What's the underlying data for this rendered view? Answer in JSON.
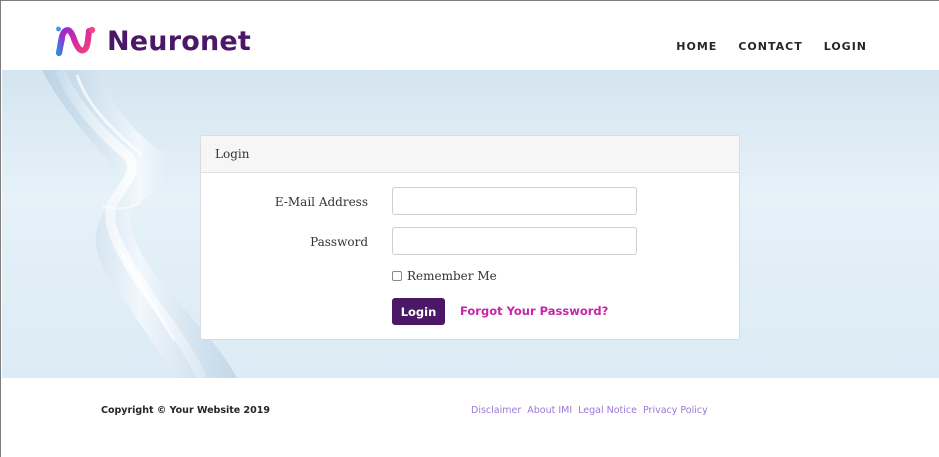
{
  "brand": {
    "name": "Neuronet",
    "logo_icon": "neuronet-logo-icon"
  },
  "nav": {
    "items": [
      {
        "label": "HOME"
      },
      {
        "label": "CONTACT"
      },
      {
        "label": "LOGIN"
      }
    ]
  },
  "login_card": {
    "title": "Login",
    "email_label": "E-Mail Address",
    "email_value": "",
    "password_label": "Password",
    "password_value": "",
    "remember_label": "Remember Me",
    "remember_checked": false,
    "submit_label": "Login",
    "forgot_label": "Forgot Your Password?"
  },
  "footer": {
    "copyright": "Copyright © Your Website 2019",
    "links": [
      {
        "label": "Disclaimer"
      },
      {
        "label": "About IMI"
      },
      {
        "label": "Legal Notice"
      },
      {
        "label": "Privacy Policy"
      }
    ]
  },
  "colors": {
    "brand_purple": "#4b1767",
    "link_magenta": "#c625a8",
    "footer_link": "#9c78d6",
    "hero_bg": "#dcebf5"
  }
}
